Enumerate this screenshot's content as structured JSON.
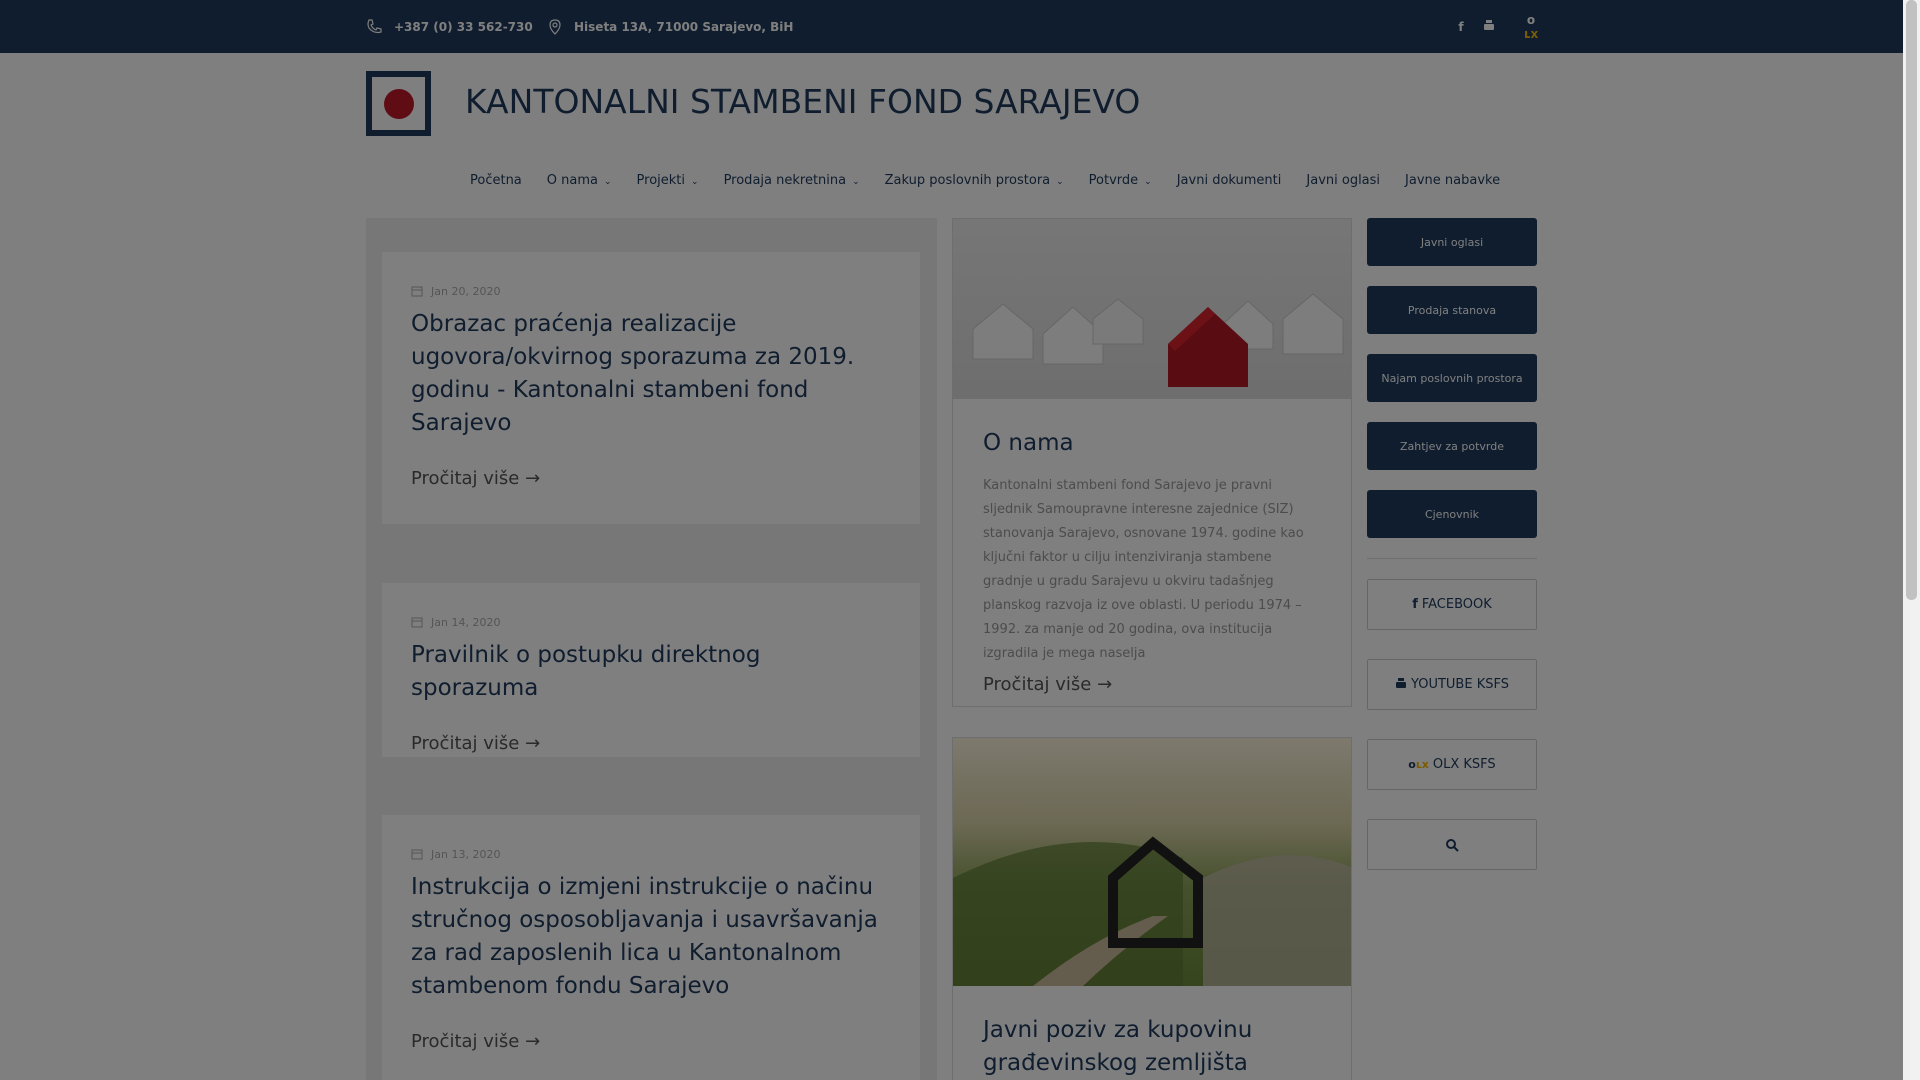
{
  "topbar": {
    "phone": "+387 (0) 33 562-730",
    "address": "Hiseta 13A, 71000 Sarajevo, BiH",
    "icons": [
      "phone-icon",
      "location-icon",
      "facebook-icon",
      "youtube-icon",
      "olx-icon"
    ]
  },
  "header": {
    "site_title": "KANTONALNI STAMBENI FOND SARAJEVO"
  },
  "nav": {
    "items": [
      {
        "label": "Početna"
      },
      {
        "label": "O nama"
      },
      {
        "label": "Projekti"
      },
      {
        "label": "Prodaja nekretnina"
      },
      {
        "label": "Zakup poslovnih prostora"
      },
      {
        "label": "Potvrde"
      },
      {
        "label": "Javni dokumenti"
      },
      {
        "label": "Javni oglasi"
      },
      {
        "label": "Javne nabavke"
      }
    ]
  },
  "posts": [
    {
      "date": "Jan 20, 2020",
      "title": "Obrazac praćenja realizacije ugovora/okvirnog sporazuma za 2019. godinu - Kantonalni stambeni fond Sarajevo",
      "more": "Pročitaj više"
    },
    {
      "date": "Jan 14, 2020",
      "title": "Pravilnik o postupku direktnog sporazuma",
      "more": "Pročitaj više"
    },
    {
      "date": "Jan 13, 2020",
      "title": "Instrukcija o izmjeni instrukcije o načinu stručnog osposobljavanja i usavršavanja za rad zaposlenih lica u Kantonalnom stambenom fondu Sarajevo",
      "more": "Pročitaj više"
    }
  ],
  "cards": [
    {
      "title": "O nama",
      "text": "Kantonalni stambeni fond Sarajevo je pravni sljednik Samoupravne interesne zajednice (SIZ) stanovanja Sarajevo, osnovane 1974. godine kao ključni faktor u cilju intenziviranja stambene gradnje u gradu Sarajevu u okviru tadašnjeg planskog razvoja iz ove oblasti. U periodu 1974 – 1992. za manje od 20 godina, ova institucija izgradila je mega naselja",
      "more": "Pročitaj više"
    },
    {
      "title": "Javni poziv za kupovinu građevinskog zemljišta"
    }
  ],
  "sidebar": {
    "buttons": [
      "Javni oglasi",
      "Prodaja stanova",
      "Najam poslovnih prostora",
      "Zahtjev za potvrde",
      "Cjenovnik"
    ],
    "social": [
      "FACEBOOK",
      "YOUTUBE KSFS",
      "OLX KSFS"
    ]
  },
  "colors": {
    "brand_navy": "#1f3a5c",
    "logo_red": "#c0182a",
    "olx_yellow": "#f2b705",
    "overlay": "rgba(0,0,0,0.5)"
  }
}
